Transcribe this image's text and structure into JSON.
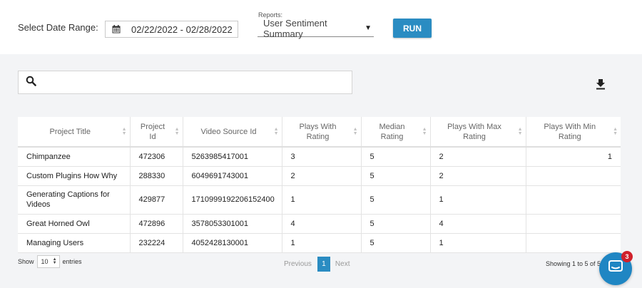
{
  "filters": {
    "date_label": "Select Date Range:",
    "date_value": "02/22/2022 - 02/28/2022",
    "reports_label": "Reports:",
    "reports_value": "User Sentiment Summary",
    "run_label": "RUN"
  },
  "search": {
    "placeholder": ""
  },
  "icons": {
    "calendar": "calendar-icon",
    "search": "search-icon",
    "download": "download-icon",
    "chat": "chat-icon",
    "sort": "sort-icon"
  },
  "colors": {
    "accent": "#2a8cc2",
    "badge": "#d0202b"
  },
  "table": {
    "columns": [
      [
        "Project Title"
      ],
      [
        "Project",
        "Id"
      ],
      [
        "Video Source Id"
      ],
      [
        "Plays With",
        "Rating"
      ],
      [
        "Median",
        "Rating"
      ],
      [
        "Plays With Max",
        "Rating"
      ],
      [
        "Plays With Min",
        "Rating"
      ]
    ],
    "rows": [
      {
        "title": "Chimpanzee",
        "project_id": "472306",
        "video_source_id": "5263985417001",
        "plays_with_rating": "3",
        "median_rating": "5",
        "plays_with_max_rating": "2",
        "plays_with_min_rating": "1"
      },
      {
        "title": "Custom Plugins How Why",
        "project_id": "288330",
        "video_source_id": "6049691743001",
        "plays_with_rating": "2",
        "median_rating": "5",
        "plays_with_max_rating": "2",
        "plays_with_min_rating": ""
      },
      {
        "title_lines": [
          "Generating Captions for",
          "Videos"
        ],
        "project_id": "429877",
        "video_source_id": "1710999192206152400",
        "plays_with_rating": "1",
        "median_rating": "5",
        "plays_with_max_rating": "1",
        "plays_with_min_rating": ""
      },
      {
        "title": "Great Horned Owl",
        "project_id": "472896",
        "video_source_id": "3578053301001",
        "plays_with_rating": "4",
        "median_rating": "5",
        "plays_with_max_rating": "4",
        "plays_with_min_rating": ""
      },
      {
        "title": "Managing Users",
        "project_id": "232224",
        "video_source_id": "4052428130001",
        "plays_with_rating": "1",
        "median_rating": "5",
        "plays_with_max_rating": "1",
        "plays_with_min_rating": ""
      }
    ]
  },
  "footer": {
    "show_label": "Show",
    "entries_value": "10",
    "entries_label": "entries",
    "prev_label": "Previous",
    "current_page": "1",
    "next_label": "Next",
    "info": "Showing 1 to 5 of 5"
  },
  "chat": {
    "badge_count": "3"
  }
}
